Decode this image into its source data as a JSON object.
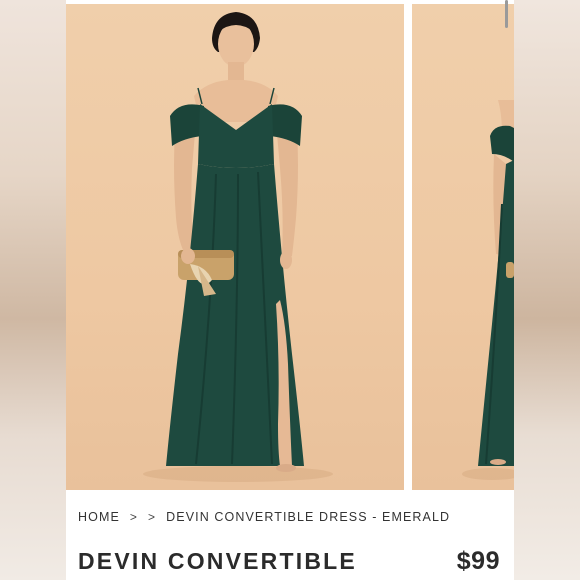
{
  "breadcrumb": {
    "home": "HOME",
    "separator": ">",
    "current": "DEVIN CONVERTIBLE DRESS - EMERALD"
  },
  "product": {
    "title": "DEVIN CONVERTIBLE",
    "price": "$99"
  },
  "colors": {
    "dress": "#1e4a3f",
    "backdrop": "#eec8a2",
    "text": "#2b2b2b"
  }
}
